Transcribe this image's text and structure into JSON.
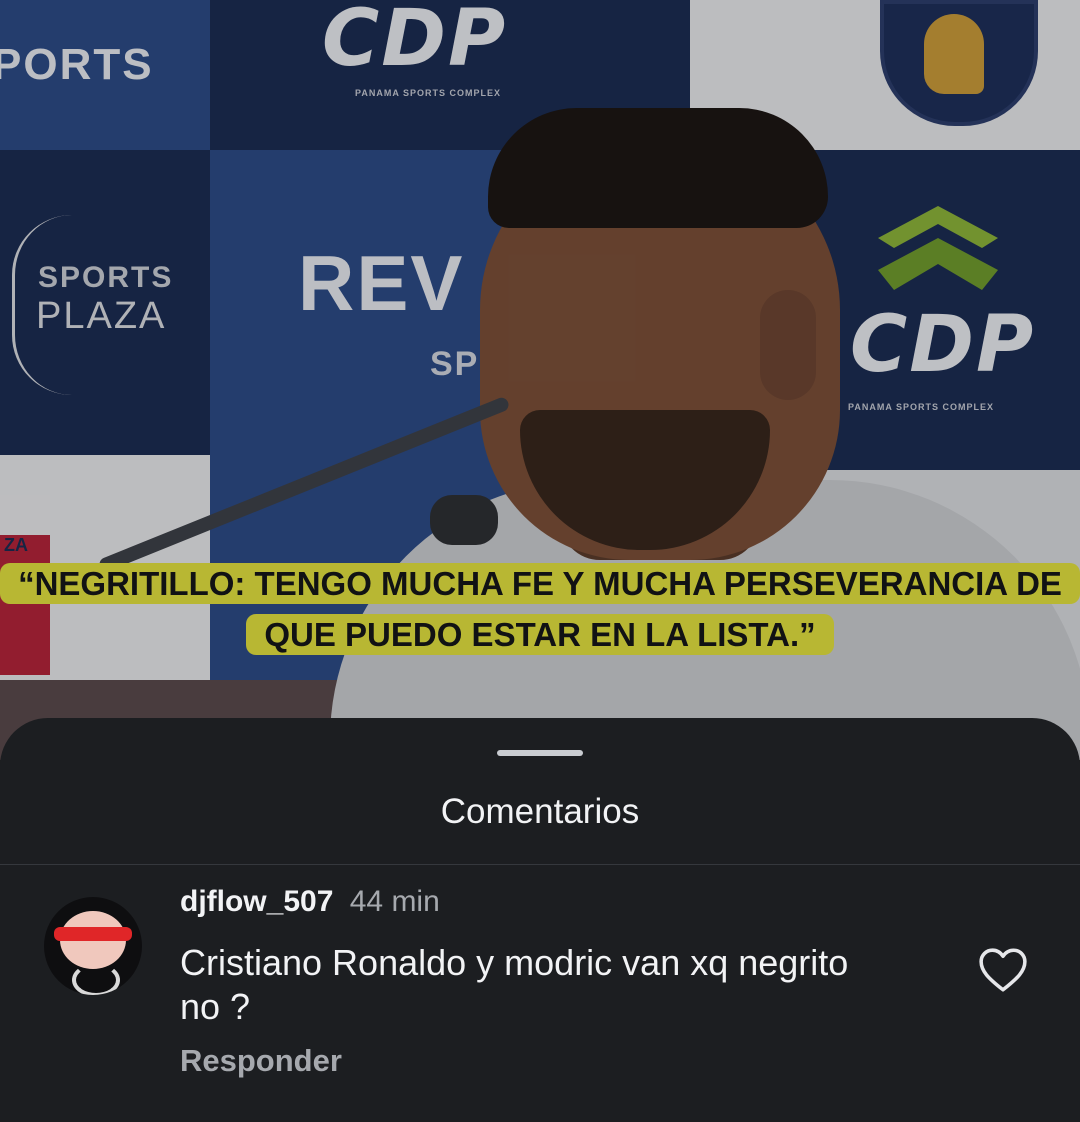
{
  "video": {
    "backdrop_texts": {
      "sports_left": "PORTS",
      "cdp_top": "CDP",
      "cdp_top_sub": "PANAMA SPORTS COMPLEX",
      "sports": "SPORTS",
      "plaza": "PLAZA",
      "rev": "REV",
      "spo": "SPO",
      "cdp_right": "CDP",
      "cdp_right_sub": "PANAMA SPORTS COMPLEX",
      "flag_letters": "ZA"
    },
    "caption": "“NEGRITILLO: TENGO MUCHA FE Y MUCHA PERSEVERANCIA DE QUE PUEDO ESTAR EN LA LISTA.”",
    "caption_color": "#b8b733"
  },
  "comments_sheet": {
    "title": "Comentarios",
    "comments": [
      {
        "author": "djflow_507",
        "time": "44 min",
        "text": "Cristiano Ronaldo y modric van xq negrito no ?",
        "reply_label": "Responder",
        "like_icon": "heart-outline-icon"
      }
    ]
  },
  "colors": {
    "sheet_bg": "#1c1e21",
    "secondary_text": "#a6a9ae"
  }
}
